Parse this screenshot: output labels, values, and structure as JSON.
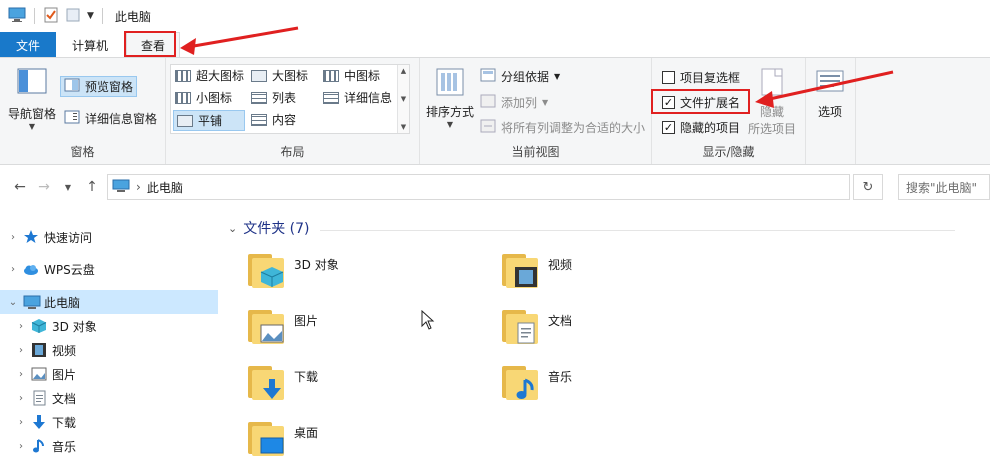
{
  "window": {
    "title": "此电脑"
  },
  "ribbon_tabs": [
    {
      "label": "文件"
    },
    {
      "label": "计算机"
    },
    {
      "label": "查看"
    }
  ],
  "ribbon": {
    "panes": {
      "nav_pane": "导航窗格",
      "preview_pane": "预览窗格",
      "details_pane": "详细信息窗格",
      "label": "窗格"
    },
    "layout": {
      "items": [
        "超大图标",
        "大图标",
        "中图标",
        "小图标",
        "列表",
        "详细信息",
        "平铺",
        "内容"
      ],
      "selected": "平铺",
      "label": "布局"
    },
    "current_view": {
      "sort": "排序方式",
      "group_by": "分组依据",
      "add_columns": "添加列",
      "fit_columns": "将所有列调整为合适的大小",
      "label": "当前视图"
    },
    "show_hide": {
      "item_checkboxes": {
        "label": "项目复选框",
        "checked": false
      },
      "file_extensions": {
        "label": "文件扩展名",
        "checked": true
      },
      "hidden_items": {
        "label": "隐藏的项目",
        "checked": true
      },
      "hide_selected": "隐藏",
      "hide_selected_sub": "所选项目",
      "label": "显示/隐藏"
    },
    "options": "选项"
  },
  "address": {
    "path": "此电脑",
    "search_placeholder": "搜索\"此电脑\""
  },
  "nav_tree": [
    {
      "label": "快速访问",
      "icon": "star-icon"
    },
    {
      "label": "WPS云盘",
      "icon": "cloud-icon"
    },
    {
      "label": "此电脑",
      "icon": "computer-icon",
      "selected": true
    },
    {
      "label": "3D 对象",
      "icon": "cube-icon"
    },
    {
      "label": "视频",
      "icon": "video-icon"
    },
    {
      "label": "图片",
      "icon": "picture-icon"
    },
    {
      "label": "文档",
      "icon": "document-icon"
    },
    {
      "label": "下载",
      "icon": "download-icon"
    },
    {
      "label": "音乐",
      "icon": "music-icon"
    }
  ],
  "content": {
    "group_title": "文件夹 (7)",
    "folders": [
      {
        "label": "3D 对象",
        "icon": "cube-icon"
      },
      {
        "label": "视频",
        "icon": "video-icon"
      },
      {
        "label": "图片",
        "icon": "picture-icon"
      },
      {
        "label": "文档",
        "icon": "document-icon"
      },
      {
        "label": "下载",
        "icon": "download-icon"
      },
      {
        "label": "音乐",
        "icon": "music-icon"
      },
      {
        "label": "桌面",
        "icon": "desktop-icon"
      }
    ]
  },
  "colors": {
    "file_tab": "#1979ca",
    "annotation": "#e02020",
    "selection": "#cce8ff"
  }
}
